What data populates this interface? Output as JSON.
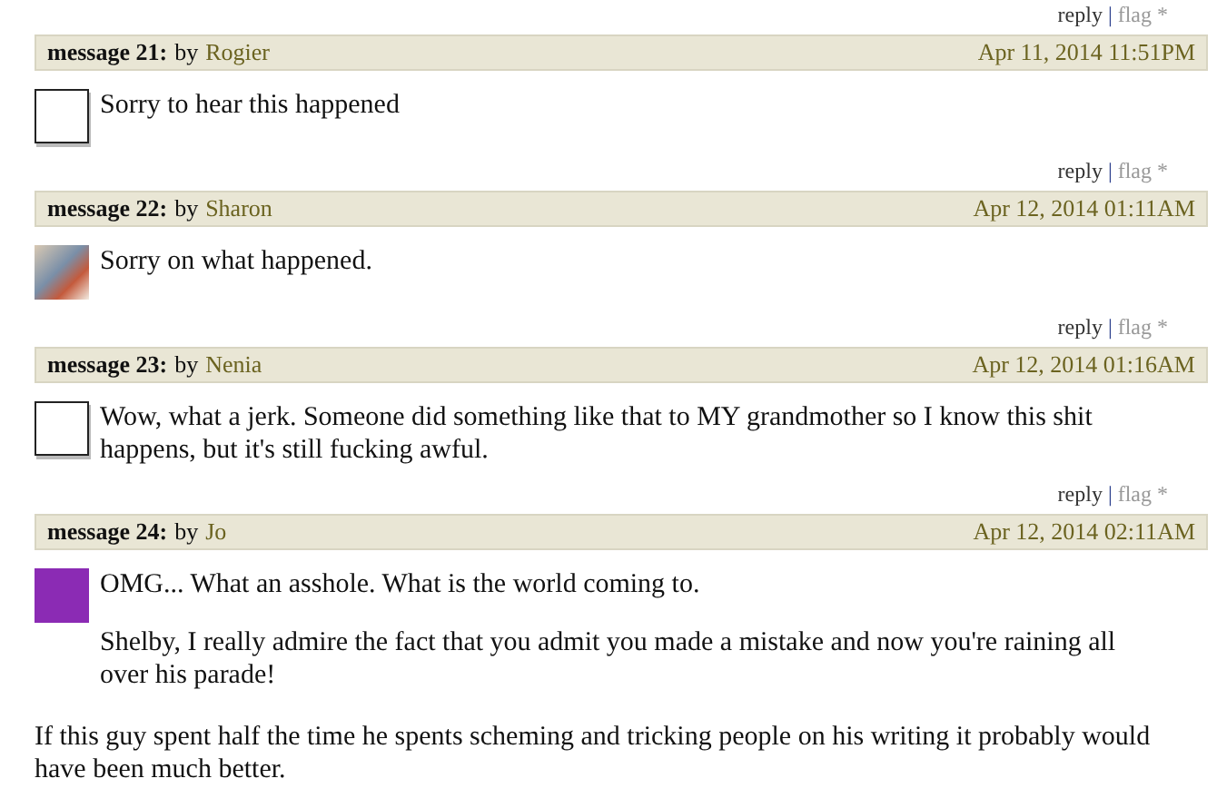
{
  "messages": [
    {
      "reply": "reply",
      "separator": "|",
      "flag": "flag *",
      "label": "message 21:",
      "by": "by",
      "author": "Rogier",
      "date": "Apr 11, 2014 11:51PM",
      "avatar": {
        "kind": "blank"
      },
      "paragraphs": [
        {
          "text": "Sorry to hear this happened",
          "beside_avatar": true
        }
      ]
    },
    {
      "reply": "reply",
      "separator": "|",
      "flag": "flag *",
      "label": "message 22:",
      "by": "by",
      "author": "Sharon",
      "date": "Apr 12, 2014 01:11AM",
      "avatar": {
        "kind": "photo"
      },
      "paragraphs": [
        {
          "text": "Sorry on what happened.",
          "beside_avatar": true
        }
      ]
    },
    {
      "reply": "reply",
      "separator": "|",
      "flag": "flag *",
      "label": "message 23:",
      "by": "by",
      "author": "Nenia",
      "date": "Apr 12, 2014 01:16AM",
      "avatar": {
        "kind": "blank"
      },
      "paragraphs": [
        {
          "text": "Wow, what a jerk. Someone did something like that to MY grandmother so I know this shit happens, but it's still fucking awful.",
          "beside_avatar": true
        }
      ]
    },
    {
      "reply": "reply",
      "separator": "|",
      "flag": "flag *",
      "label": "message 24:",
      "by": "by",
      "author": "Jo",
      "date": "Apr 12, 2014 02:11AM",
      "avatar": {
        "kind": "poster"
      },
      "paragraphs": [
        {
          "text": "OMG... What an asshole. What is the world coming to.",
          "beside_avatar": true
        },
        {
          "text": "Shelby, I really admire the fact that you admit you made a mistake and now you're raining all over his parade!",
          "beside_avatar": true
        },
        {
          "text": "If this guy spent half the time he spents scheming and tricking people on his writing it probably would have been much better.",
          "beside_avatar": false
        }
      ]
    }
  ]
}
